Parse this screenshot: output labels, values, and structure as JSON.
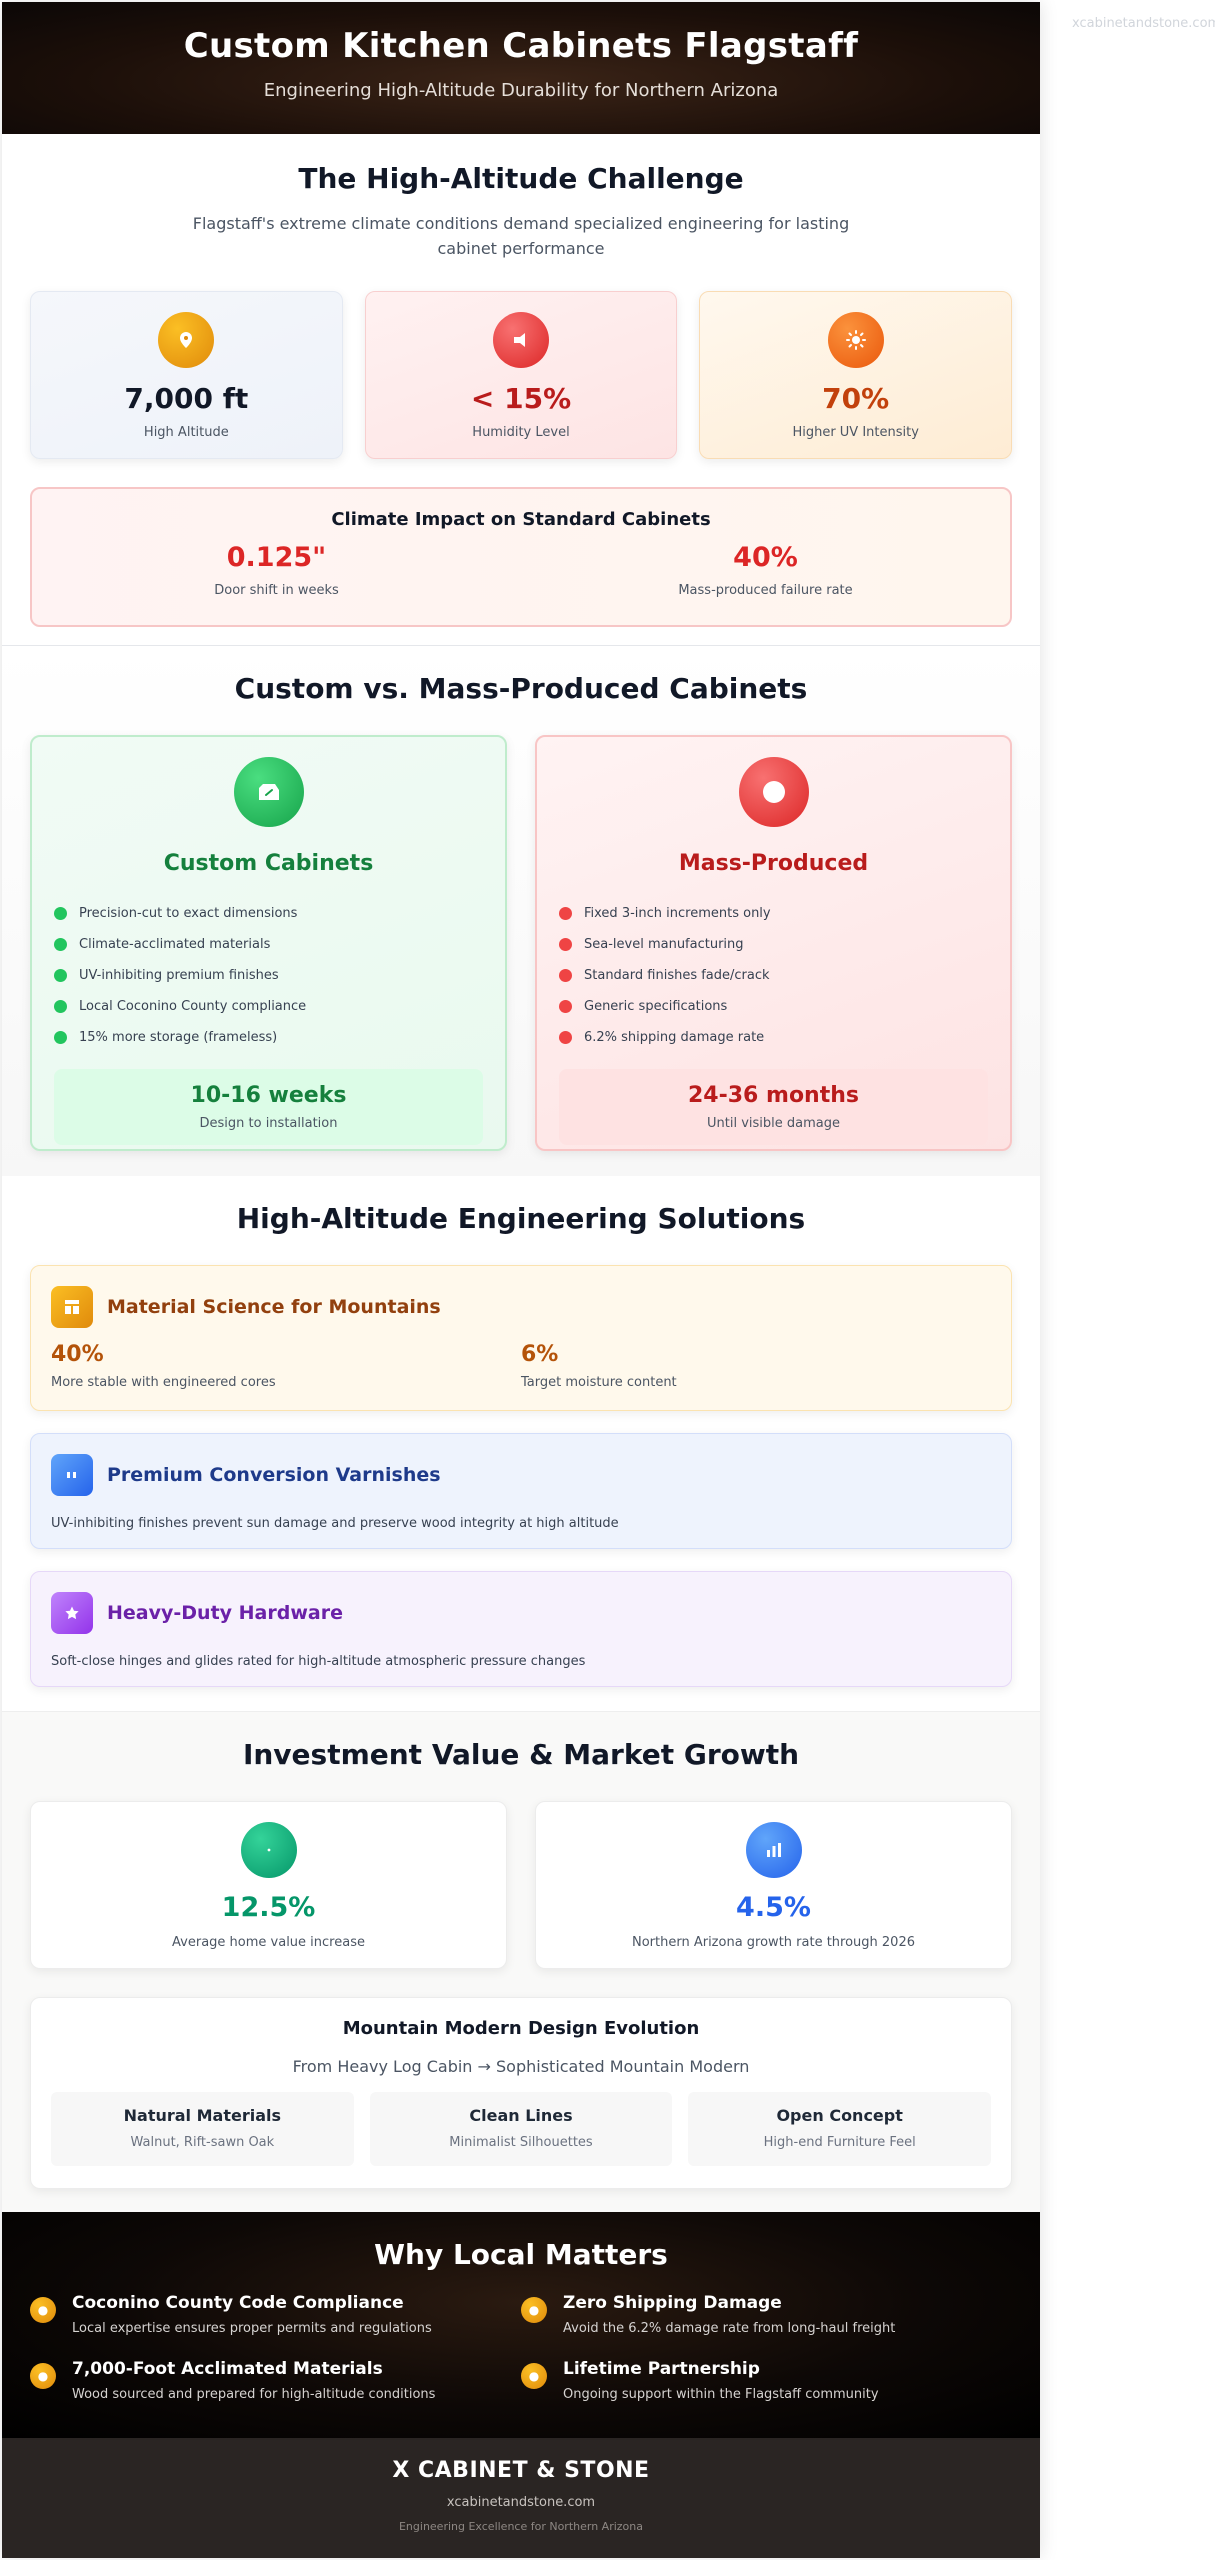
{
  "watermark": "xcabinetandstone.com",
  "header": {
    "title": "Custom Kitchen Cabinets Flagstaff",
    "subtitle": "Engineering High-Altitude Durability for Northern Arizona"
  },
  "challenge": {
    "title": "The High-Altitude Challenge",
    "subtitle": "Flagstaff's extreme climate conditions demand specialized engineering for lasting cabinet performance",
    "stats": [
      {
        "icon": "location-pin-icon",
        "value": "7,000 ft",
        "label": "High Altitude",
        "color": "#111827"
      },
      {
        "icon": "droplet-icon",
        "value": "< 15%",
        "label": "Humidity Level",
        "color": "#b91c1c"
      },
      {
        "icon": "sun-icon",
        "value": "70%",
        "label": "Higher UV Intensity",
        "color": "#c2410c"
      }
    ],
    "impact": {
      "title": "Climate Impact on Standard Cabinets",
      "items": [
        {
          "value": "0.125\"",
          "label": "Door shift in weeks"
        },
        {
          "value": "40%",
          "label": "Mass-produced failure rate"
        }
      ]
    }
  },
  "compare": {
    "title": "Custom vs. Mass-Produced Cabinets",
    "custom": {
      "icon": "leaf-icon",
      "title": "Custom Cabinets",
      "items": [
        "Precision-cut to exact dimensions",
        "Climate-acclimated materials",
        "UV-inhibiting premium finishes",
        "Local Coconino County compliance",
        "15% more storage (frameless)"
      ],
      "footer_value": "10-16 weeks",
      "footer_label": "Design to installation"
    },
    "mass": {
      "icon": "factory-icon",
      "title": "Mass-Produced",
      "items": [
        "Fixed 3-inch increments only",
        "Sea-level manufacturing",
        "Standard finishes fade/crack",
        "Generic specifications",
        "6.2% shipping damage rate"
      ],
      "footer_value": "24-36 months",
      "footer_label": "Until visible damage"
    }
  },
  "engineering": {
    "title": "High-Altitude Engineering Solutions",
    "material": {
      "icon": "layers-icon",
      "title": "Material Science for Mountains",
      "stats": [
        {
          "value": "40%",
          "label": "More stable with engineered cores"
        },
        {
          "value": "6%",
          "label": "Target moisture content"
        }
      ]
    },
    "varnish": {
      "icon": "brush-icon",
      "title": "Premium Conversion Varnishes",
      "desc": "UV-inhibiting finishes prevent sun damage and preserve wood integrity at high altitude"
    },
    "hardware": {
      "icon": "star-icon",
      "title": "Heavy-Duty Hardware",
      "desc": "Soft-close hinges and glides rated for high-altitude atmospheric pressure changes"
    }
  },
  "investment": {
    "title": "Investment Value & Market Growth",
    "cards": [
      {
        "icon": "dollar-icon",
        "value": "12.5%",
        "label": "Average home value increase"
      },
      {
        "icon": "bar-chart-icon",
        "value": "4.5%",
        "label": "Northern Arizona growth rate through 2026"
      }
    ],
    "design": {
      "title": "Mountain Modern Design Evolution",
      "evolution": "From Heavy Log Cabin → Sophisticated Mountain Modern",
      "boxes": [
        {
          "title": "Natural Materials",
          "sub": "Walnut, Rift-sawn Oak"
        },
        {
          "title": "Clean Lines",
          "sub": "Minimalist Silhouettes"
        },
        {
          "title": "Open Concept",
          "sub": "High-end Furniture Feel"
        }
      ]
    }
  },
  "local": {
    "title": "Why Local Matters",
    "items": [
      {
        "title": "Coconino County Code Compliance",
        "desc": "Local expertise ensures proper permits and regulations"
      },
      {
        "title": "Zero Shipping Damage",
        "desc": "Avoid the 6.2% damage rate from long-haul freight"
      },
      {
        "title": "7,000-Foot Acclimated Materials",
        "desc": "Wood sourced and prepared for high-altitude conditions"
      },
      {
        "title": "Lifetime Partnership",
        "desc": "Ongoing support within the Flagstaff community"
      }
    ]
  },
  "footer": {
    "brand": "X CABINET & STONE",
    "site": "xcabinetandstone.com",
    "tagline": "Engineering Excellence for Northern Arizona"
  }
}
